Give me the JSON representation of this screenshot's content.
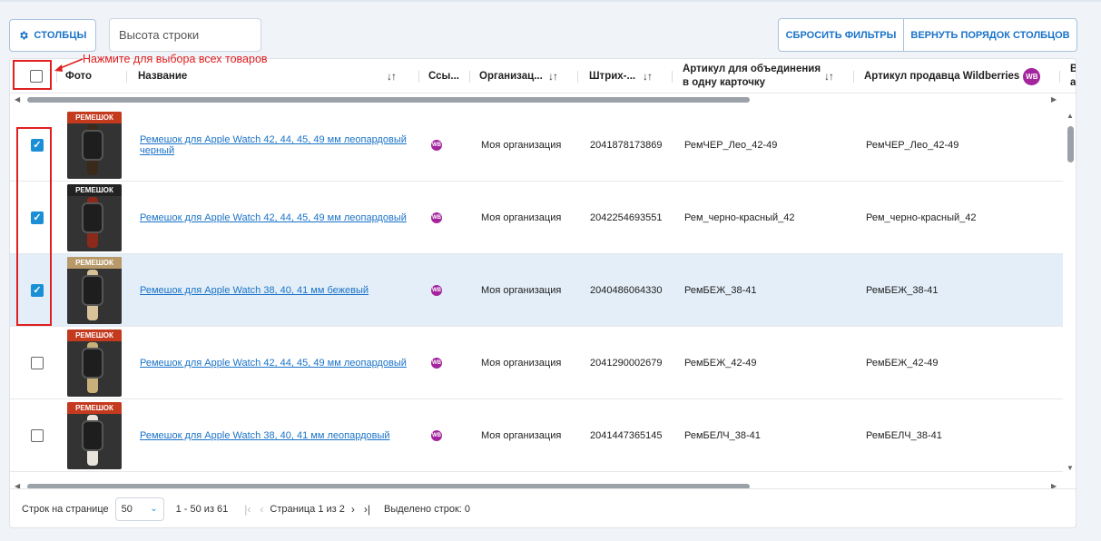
{
  "toolbar": {
    "columns_label": "СТОЛБЦЫ",
    "row_height_placeholder": "Высота строки",
    "reset_filters_label": "СБРОСИТЬ ФИЛЬТРЫ",
    "restore_column_order_label": "ВЕРНУТЬ ПОРЯДОК СТОЛБЦОВ",
    "accent_color": "#1a73c8"
  },
  "columns": {
    "photo": "Фото",
    "name": "Название",
    "link": "Ссы...",
    "organization": "Организац...",
    "barcode": "Штрих-...",
    "merge_article_line1": "Артикул для объединения",
    "merge_article_line2": "в одну карточку",
    "seller_article": "Артикул продавца Wildberries",
    "next_col_line1": "В",
    "next_col_line2": "а",
    "sort_icon": "↓↑"
  },
  "wb_badge_text": "WB",
  "rows": [
    {
      "name": "Ремешок для Apple Watch 42, 44, 45, 49 мм леопардовый черный",
      "org": "Моя организация",
      "barcode": "2041878173869",
      "merge_article": "РемЧЕР_Лео_42-49",
      "seller_article": "РемЧЕР_Лео_42-49",
      "checked": true,
      "selected": false,
      "photo_band": "РЕМЕШОК",
      "band_color": "#c43a1e",
      "strap_color": "#3a2a1a"
    },
    {
      "name": "Ремешок для Apple Watch 42, 44, 45, 49 мм леопардовый",
      "org": "Моя организация",
      "barcode": "2042254693551",
      "merge_article": "Рем_черно-красный_42",
      "seller_article": "Рем_черно-красный_42",
      "checked": true,
      "selected": false,
      "photo_band": "РЕМЕШОК",
      "band_color": "#222222",
      "strap_color": "#8b2a1a"
    },
    {
      "name": "Ремешок для Apple Watch 38, 40, 41 мм бежевый",
      "org": "Моя организация",
      "barcode": "2040486064330",
      "merge_article": "РемБЕЖ_38-41",
      "seller_article": "РемБЕЖ_38-41",
      "checked": true,
      "selected": true,
      "photo_band": "РЕМЕШОК",
      "band_color": "#b89a6a",
      "strap_color": "#d8c29a"
    },
    {
      "name": "Ремешок для Apple Watch 42, 44, 45, 49 мм леопардовый",
      "org": "Моя организация",
      "barcode": "2041290002679",
      "merge_article": "РемБЕЖ_42-49",
      "seller_article": "РемБЕЖ_42-49",
      "checked": false,
      "selected": false,
      "photo_band": "РЕМЕШОК",
      "band_color": "#c43a1e",
      "strap_color": "#c9b07a"
    },
    {
      "name": "Ремешок для Apple Watch 38, 40, 41 мм леопардовый",
      "org": "Моя организация",
      "barcode": "2041447365145",
      "merge_article": "РемБЕЛЧ_38-41",
      "seller_article": "РемБЕЛЧ_38-41",
      "checked": false,
      "selected": false,
      "photo_band": "РЕМЕШОК",
      "band_color": "#c43a1e",
      "strap_color": "#e8e4dc"
    }
  ],
  "footer": {
    "rows_per_page_label": "Строк на странице",
    "rows_per_page_value": "50",
    "range": "1 - 50 из 61",
    "page_label": "Страница 1 из 2",
    "selected_rows": "Выделено строк: 0"
  },
  "annotation": {
    "text": "Нажмите для выбора всех товаров",
    "color": "#e02020"
  }
}
